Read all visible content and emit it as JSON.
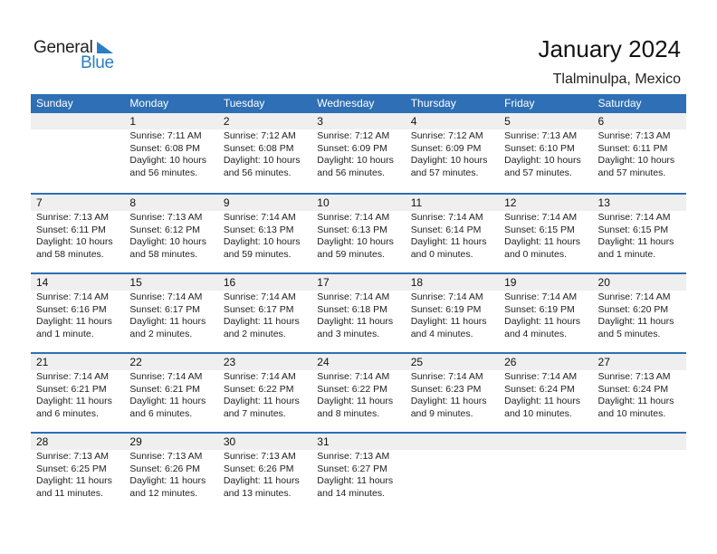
{
  "logo": {
    "word1": "General",
    "word2": "Blue"
  },
  "header": {
    "title": "January 2024",
    "location": "Tlalminulpa, Mexico"
  },
  "colors": {
    "accent": "#2e6fb5",
    "daynum_bg": "#efefef",
    "logo_blue": "#2a7fc3"
  },
  "weekdays": [
    "Sunday",
    "Monday",
    "Tuesday",
    "Wednesday",
    "Thursday",
    "Friday",
    "Saturday"
  ],
  "weeks": [
    [
      null,
      {
        "day": "1",
        "sunrise": "Sunrise: 7:11 AM",
        "sunset": "Sunset: 6:08 PM",
        "daylight1": "Daylight: 10 hours",
        "daylight2": "and 56 minutes."
      },
      {
        "day": "2",
        "sunrise": "Sunrise: 7:12 AM",
        "sunset": "Sunset: 6:08 PM",
        "daylight1": "Daylight: 10 hours",
        "daylight2": "and 56 minutes."
      },
      {
        "day": "3",
        "sunrise": "Sunrise: 7:12 AM",
        "sunset": "Sunset: 6:09 PM",
        "daylight1": "Daylight: 10 hours",
        "daylight2": "and 56 minutes."
      },
      {
        "day": "4",
        "sunrise": "Sunrise: 7:12 AM",
        "sunset": "Sunset: 6:09 PM",
        "daylight1": "Daylight: 10 hours",
        "daylight2": "and 57 minutes."
      },
      {
        "day": "5",
        "sunrise": "Sunrise: 7:13 AM",
        "sunset": "Sunset: 6:10 PM",
        "daylight1": "Daylight: 10 hours",
        "daylight2": "and 57 minutes."
      },
      {
        "day": "6",
        "sunrise": "Sunrise: 7:13 AM",
        "sunset": "Sunset: 6:11 PM",
        "daylight1": "Daylight: 10 hours",
        "daylight2": "and 57 minutes."
      }
    ],
    [
      {
        "day": "7",
        "sunrise": "Sunrise: 7:13 AM",
        "sunset": "Sunset: 6:11 PM",
        "daylight1": "Daylight: 10 hours",
        "daylight2": "and 58 minutes."
      },
      {
        "day": "8",
        "sunrise": "Sunrise: 7:13 AM",
        "sunset": "Sunset: 6:12 PM",
        "daylight1": "Daylight: 10 hours",
        "daylight2": "and 58 minutes."
      },
      {
        "day": "9",
        "sunrise": "Sunrise: 7:14 AM",
        "sunset": "Sunset: 6:13 PM",
        "daylight1": "Daylight: 10 hours",
        "daylight2": "and 59 minutes."
      },
      {
        "day": "10",
        "sunrise": "Sunrise: 7:14 AM",
        "sunset": "Sunset: 6:13 PM",
        "daylight1": "Daylight: 10 hours",
        "daylight2": "and 59 minutes."
      },
      {
        "day": "11",
        "sunrise": "Sunrise: 7:14 AM",
        "sunset": "Sunset: 6:14 PM",
        "daylight1": "Daylight: 11 hours",
        "daylight2": "and 0 minutes."
      },
      {
        "day": "12",
        "sunrise": "Sunrise: 7:14 AM",
        "sunset": "Sunset: 6:15 PM",
        "daylight1": "Daylight: 11 hours",
        "daylight2": "and 0 minutes."
      },
      {
        "day": "13",
        "sunrise": "Sunrise: 7:14 AM",
        "sunset": "Sunset: 6:15 PM",
        "daylight1": "Daylight: 11 hours",
        "daylight2": "and 1 minute."
      }
    ],
    [
      {
        "day": "14",
        "sunrise": "Sunrise: 7:14 AM",
        "sunset": "Sunset: 6:16 PM",
        "daylight1": "Daylight: 11 hours",
        "daylight2": "and 1 minute."
      },
      {
        "day": "15",
        "sunrise": "Sunrise: 7:14 AM",
        "sunset": "Sunset: 6:17 PM",
        "daylight1": "Daylight: 11 hours",
        "daylight2": "and 2 minutes."
      },
      {
        "day": "16",
        "sunrise": "Sunrise: 7:14 AM",
        "sunset": "Sunset: 6:17 PM",
        "daylight1": "Daylight: 11 hours",
        "daylight2": "and 2 minutes."
      },
      {
        "day": "17",
        "sunrise": "Sunrise: 7:14 AM",
        "sunset": "Sunset: 6:18 PM",
        "daylight1": "Daylight: 11 hours",
        "daylight2": "and 3 minutes."
      },
      {
        "day": "18",
        "sunrise": "Sunrise: 7:14 AM",
        "sunset": "Sunset: 6:19 PM",
        "daylight1": "Daylight: 11 hours",
        "daylight2": "and 4 minutes."
      },
      {
        "day": "19",
        "sunrise": "Sunrise: 7:14 AM",
        "sunset": "Sunset: 6:19 PM",
        "daylight1": "Daylight: 11 hours",
        "daylight2": "and 4 minutes."
      },
      {
        "day": "20",
        "sunrise": "Sunrise: 7:14 AM",
        "sunset": "Sunset: 6:20 PM",
        "daylight1": "Daylight: 11 hours",
        "daylight2": "and 5 minutes."
      }
    ],
    [
      {
        "day": "21",
        "sunrise": "Sunrise: 7:14 AM",
        "sunset": "Sunset: 6:21 PM",
        "daylight1": "Daylight: 11 hours",
        "daylight2": "and 6 minutes."
      },
      {
        "day": "22",
        "sunrise": "Sunrise: 7:14 AM",
        "sunset": "Sunset: 6:21 PM",
        "daylight1": "Daylight: 11 hours",
        "daylight2": "and 6 minutes."
      },
      {
        "day": "23",
        "sunrise": "Sunrise: 7:14 AM",
        "sunset": "Sunset: 6:22 PM",
        "daylight1": "Daylight: 11 hours",
        "daylight2": "and 7 minutes."
      },
      {
        "day": "24",
        "sunrise": "Sunrise: 7:14 AM",
        "sunset": "Sunset: 6:22 PM",
        "daylight1": "Daylight: 11 hours",
        "daylight2": "and 8 minutes."
      },
      {
        "day": "25",
        "sunrise": "Sunrise: 7:14 AM",
        "sunset": "Sunset: 6:23 PM",
        "daylight1": "Daylight: 11 hours",
        "daylight2": "and 9 minutes."
      },
      {
        "day": "26",
        "sunrise": "Sunrise: 7:14 AM",
        "sunset": "Sunset: 6:24 PM",
        "daylight1": "Daylight: 11 hours",
        "daylight2": "and 10 minutes."
      },
      {
        "day": "27",
        "sunrise": "Sunrise: 7:13 AM",
        "sunset": "Sunset: 6:24 PM",
        "daylight1": "Daylight: 11 hours",
        "daylight2": "and 10 minutes."
      }
    ],
    [
      {
        "day": "28",
        "sunrise": "Sunrise: 7:13 AM",
        "sunset": "Sunset: 6:25 PM",
        "daylight1": "Daylight: 11 hours",
        "daylight2": "and 11 minutes."
      },
      {
        "day": "29",
        "sunrise": "Sunrise: 7:13 AM",
        "sunset": "Sunset: 6:26 PM",
        "daylight1": "Daylight: 11 hours",
        "daylight2": "and 12 minutes."
      },
      {
        "day": "30",
        "sunrise": "Sunrise: 7:13 AM",
        "sunset": "Sunset: 6:26 PM",
        "daylight1": "Daylight: 11 hours",
        "daylight2": "and 13 minutes."
      },
      {
        "day": "31",
        "sunrise": "Sunrise: 7:13 AM",
        "sunset": "Sunset: 6:27 PM",
        "daylight1": "Daylight: 11 hours",
        "daylight2": "and 14 minutes."
      },
      null,
      null,
      null
    ]
  ]
}
